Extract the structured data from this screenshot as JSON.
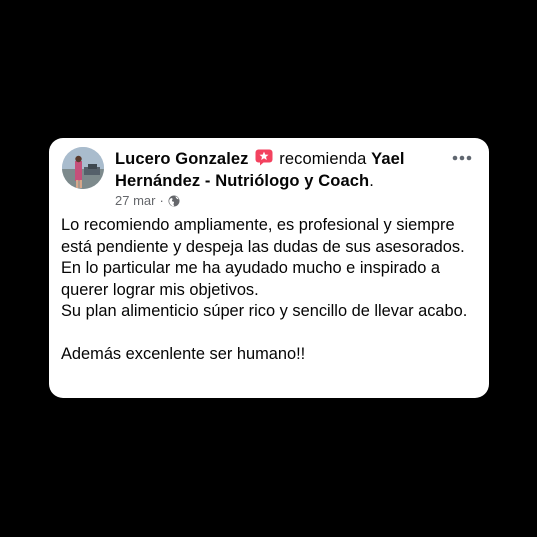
{
  "post": {
    "author": "Lucero Gonzalez",
    "verb": "recomienda",
    "page_name": "Yael Hernández - Nutriólogo y Coach",
    "period": ".",
    "date": "27 mar",
    "separator": "·",
    "body": "Lo recomiendo ampliamente, es profesional y siempre está pendiente y despeja las dudas de sus asesorados.\nEn lo particular me ha ayudado mucho e inspirado a querer lograr mis objetivos.\nSu plan alimenticio súper rico y sencillo de llevar acabo.\n\nAdemás excenlente ser humano!!"
  },
  "icons": {
    "badge": "recommend-star-icon",
    "privacy": "globe-icon",
    "menu": "more-options-icon"
  },
  "colors": {
    "page_background": "#000000",
    "card_background": "#ffffff",
    "text": "#050505",
    "muted_text": "#65676b",
    "recommend_badge": "#f3425f"
  }
}
